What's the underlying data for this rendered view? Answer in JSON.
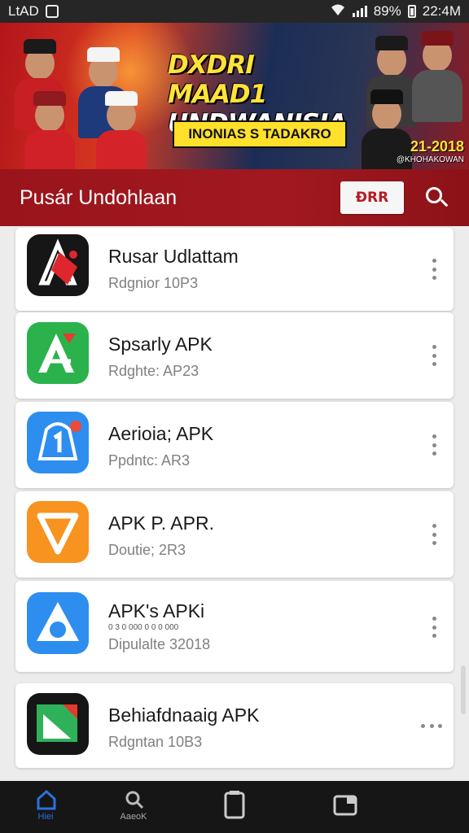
{
  "status_bar": {
    "carrier": "LtAD",
    "battery_percent": "89%",
    "time": "22:4M"
  },
  "banner": {
    "title_line1": "DXDRI MAAD1",
    "title_line2": "UNDWANISIA",
    "subtitle": "INONIAS S TADAKRO",
    "year": "21-2018",
    "year_caption": "@KHOHAKOWAN"
  },
  "header": {
    "title": "Pusár Undohlaan",
    "action_label": "ĐRR"
  },
  "apps": [
    {
      "name": "Rusar Udlattam",
      "meta": "Rdgnior 10P3",
      "icon": "red-a-logo-icon",
      "menu": "vertical"
    },
    {
      "name": "Spsarly APK",
      "meta": "Rdghte: AP23",
      "icon": "green-a-logo-icon",
      "menu": "vertical"
    },
    {
      "name": "Aerioia; APK",
      "meta": "Ppdntc: AR3",
      "icon": "blue-bell-icon",
      "menu": "vertical"
    },
    {
      "name": "APK P. APR.",
      "meta": "Doutie; 2R3",
      "icon": "orange-v-icon",
      "menu": "vertical"
    },
    {
      "name": "APK's APKi",
      "tag": "0 3 0 000 0 0 0 000",
      "meta": "Dipulalte 32018",
      "icon": "blue-triangle-icon",
      "menu": "vertical"
    },
    {
      "name": "Behiafdnaaig APK",
      "meta": "Rdgntan 10B3",
      "icon": "green-flag-icon",
      "menu": "horizontal"
    }
  ],
  "bottom_nav": [
    {
      "label": "Hiei",
      "icon": "home-icon",
      "active": true
    },
    {
      "label": "AaeoK",
      "icon": "search-icon",
      "active": false
    },
    {
      "label": "",
      "icon": "phone-icon",
      "active": false
    },
    {
      "label": "",
      "icon": "tablet-icon",
      "active": false
    }
  ],
  "colors": {
    "header_red": "#a11920",
    "accent_blue": "#2d6fe0",
    "nav_bg": "#161616"
  }
}
